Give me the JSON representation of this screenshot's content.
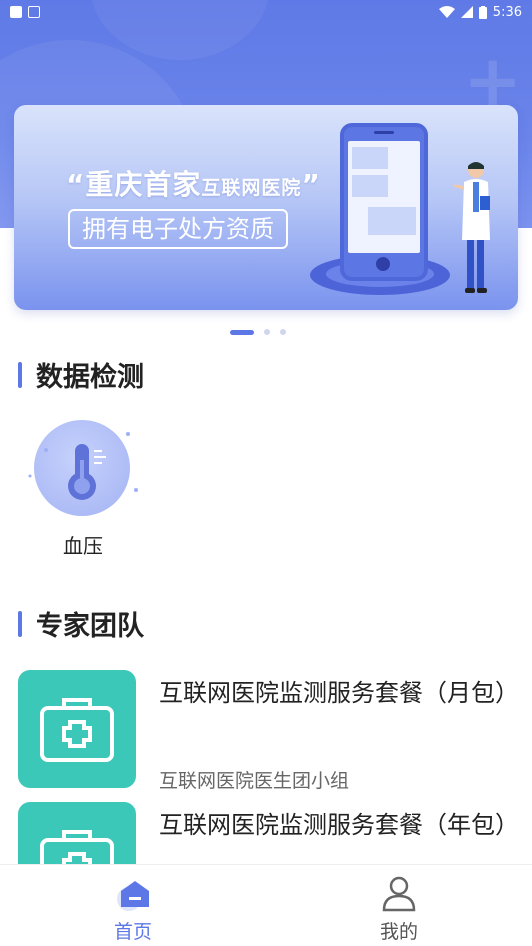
{
  "status_bar": {
    "time": "5:36"
  },
  "banner": {
    "quote_open": "“",
    "title_main": "重庆首家",
    "title_small": "互联网医院",
    "quote_close": "”",
    "subtitle": "拥有电子处方资质"
  },
  "sections": {
    "data_detection": "数据检测",
    "expert_team": "专家团队"
  },
  "detection": [
    {
      "label": "血压",
      "icon": "thermometer-icon"
    }
  ],
  "packages": [
    {
      "name": "互联网医院监测服务套餐（月包）",
      "team": "互联网医院医生团小组",
      "icon": "medical-kit-icon"
    },
    {
      "name": "互联网医院监测服务套餐（年包）",
      "team": "",
      "icon": "medical-kit-icon"
    }
  ],
  "nav": {
    "home": "首页",
    "mine": "我的"
  },
  "colors": {
    "primary": "#5d78e6",
    "teal": "#3cc8b8"
  }
}
